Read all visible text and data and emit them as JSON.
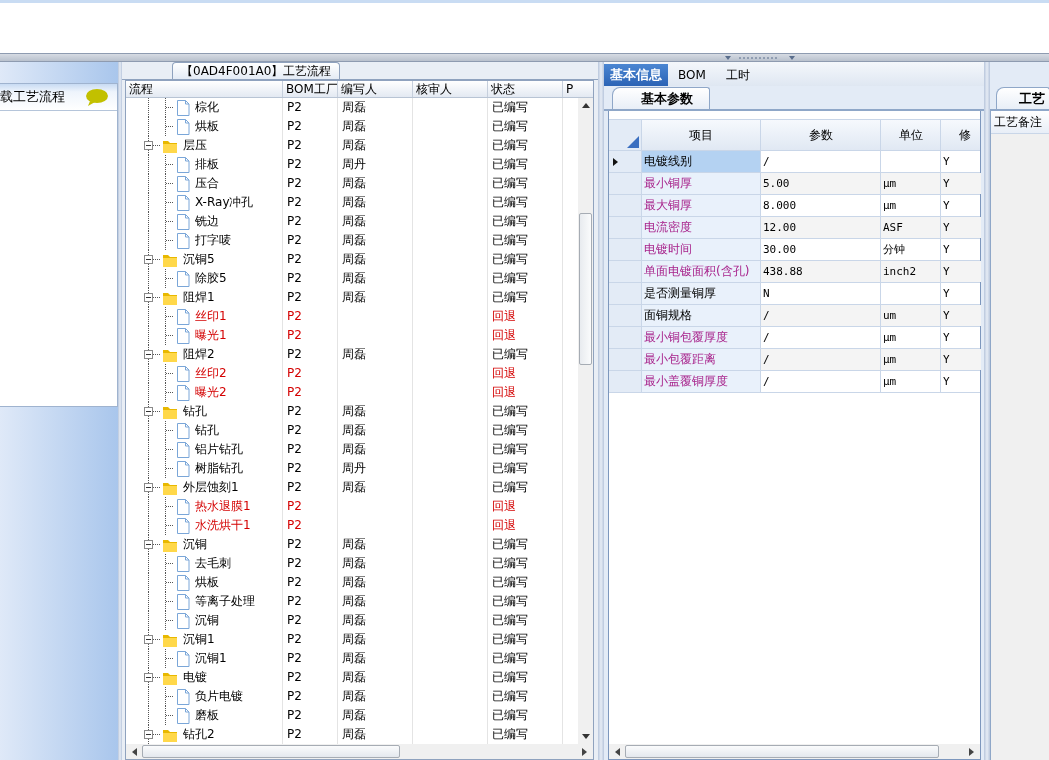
{
  "left_panel": {
    "title": "载工艺流程"
  },
  "process_panel": {
    "title": "【0AD4F001A0】工艺流程",
    "columns": [
      "流程",
      "BOM工厂",
      "编写人",
      "核审人",
      "状态",
      "P"
    ],
    "continued_children": [
      {
        "name": "棕化",
        "bom": "P2",
        "writer": "周磊",
        "status": "已编写",
        "returned": false
      },
      {
        "name": "烘板",
        "bom": "P2",
        "writer": "周磊",
        "status": "已编写",
        "returned": false
      }
    ],
    "nodes": [
      {
        "name": "层压",
        "bom": "P2",
        "writer": "周磊",
        "status": "已编写",
        "returned": false,
        "expanded": true,
        "children": [
          {
            "name": "排板",
            "bom": "P2",
            "writer": "周丹",
            "status": "已编写",
            "returned": false
          },
          {
            "name": "压合",
            "bom": "P2",
            "writer": "周磊",
            "status": "已编写",
            "returned": false
          },
          {
            "name": "X-Ray冲孔",
            "bom": "P2",
            "writer": "周磊",
            "status": "已编写",
            "returned": false
          },
          {
            "name": "铣边",
            "bom": "P2",
            "writer": "周磊",
            "status": "已编写",
            "returned": false
          },
          {
            "name": "打字唛",
            "bom": "P2",
            "writer": "周磊",
            "status": "已编写",
            "returned": false
          }
        ]
      },
      {
        "name": "沉铜5",
        "bom": "P2",
        "writer": "周磊",
        "status": "已编写",
        "returned": false,
        "expanded": true,
        "children": [
          {
            "name": "除胶5",
            "bom": "P2",
            "writer": "周磊",
            "status": "已编写",
            "returned": false
          }
        ]
      },
      {
        "name": "阻焊1",
        "bom": "P2",
        "writer": "周磊",
        "status": "已编写",
        "returned": false,
        "expanded": true,
        "children": [
          {
            "name": "丝印1",
            "bom": "P2",
            "status": "回退",
            "returned": true
          },
          {
            "name": "曝光1",
            "bom": "P2",
            "status": "回退",
            "returned": true
          }
        ]
      },
      {
        "name": "阻焊2",
        "bom": "P2",
        "writer": "周磊",
        "status": "已编写",
        "returned": false,
        "expanded": true,
        "children": [
          {
            "name": "丝印2",
            "bom": "P2",
            "status": "回退",
            "returned": true
          },
          {
            "name": "曝光2",
            "bom": "P2",
            "status": "回退",
            "returned": true
          }
        ]
      },
      {
        "name": "钻孔",
        "bom": "P2",
        "writer": "周磊",
        "status": "已编写",
        "returned": false,
        "expanded": true,
        "children": [
          {
            "name": "钻孔",
            "bom": "P2",
            "writer": "周磊",
            "status": "已编写",
            "returned": false
          },
          {
            "name": "铝片钻孔",
            "bom": "P2",
            "writer": "周磊",
            "status": "已编写",
            "returned": false
          },
          {
            "name": "树脂钻孔",
            "bom": "P2",
            "writer": "周丹",
            "status": "已编写",
            "returned": false
          }
        ]
      },
      {
        "name": "外层蚀刻1",
        "bom": "P2",
        "writer": "周磊",
        "status": "已编写",
        "returned": false,
        "expanded": true,
        "children": [
          {
            "name": "热水退膜1",
            "bom": "P2",
            "status": "回退",
            "returned": true
          },
          {
            "name": "水洗烘干1",
            "bom": "P2",
            "status": "回退",
            "returned": true
          }
        ]
      },
      {
        "name": "沉铜",
        "bom": "P2",
        "writer": "周磊",
        "status": "已编写",
        "returned": false,
        "expanded": true,
        "children": [
          {
            "name": "去毛刺",
            "bom": "P2",
            "writer": "周磊",
            "status": "已编写",
            "returned": false
          },
          {
            "name": "烘板",
            "bom": "P2",
            "writer": "周磊",
            "status": "已编写",
            "returned": false
          },
          {
            "name": "等离子处理",
            "bom": "P2",
            "writer": "周磊",
            "status": "已编写",
            "returned": false
          },
          {
            "name": "沉铜",
            "bom": "P2",
            "writer": "周磊",
            "status": "已编写",
            "returned": false
          }
        ]
      },
      {
        "name": "沉铜1",
        "bom": "P2",
        "writer": "周磊",
        "status": "已编写",
        "returned": false,
        "expanded": true,
        "children": [
          {
            "name": "沉铜1",
            "bom": "P2",
            "writer": "周磊",
            "status": "已编写",
            "returned": false
          }
        ]
      },
      {
        "name": "电镀",
        "bom": "P2",
        "writer": "周磊",
        "status": "已编写",
        "returned": false,
        "expanded": true,
        "children": [
          {
            "name": "负片电镀",
            "bom": "P2",
            "writer": "周磊",
            "status": "已编写",
            "returned": false
          },
          {
            "name": "磨板",
            "bom": "P2",
            "writer": "周磊",
            "status": "已编写",
            "returned": false
          }
        ]
      },
      {
        "name": "钻孔2",
        "bom": "P2",
        "writer": "周磊",
        "status": "已编写",
        "returned": false,
        "expanded": true
      }
    ]
  },
  "info_panel": {
    "tabs": [
      {
        "label": "基本信息",
        "selected": true
      },
      {
        "label": "BOM",
        "selected": false
      },
      {
        "label": "工时",
        "selected": false
      }
    ],
    "subtab": "基本参数",
    "columns": [
      "项目",
      "参数",
      "单位",
      "修"
    ],
    "rows": [
      {
        "item": "电镀线别",
        "required": false,
        "value": "/",
        "modified": "Y",
        "selected": true
      },
      {
        "item": "最小铜厚",
        "required": true,
        "value": "5.00",
        "unit": "µm",
        "modified": "Y",
        "selected": false
      },
      {
        "item": "最大铜厚",
        "required": true,
        "value": "8.000",
        "unit": "µm",
        "modified": "Y",
        "selected": false
      },
      {
        "item": "电流密度",
        "required": true,
        "value": "12.00",
        "unit": "ASF",
        "modified": "Y",
        "selected": false
      },
      {
        "item": "电镀时间",
        "required": true,
        "value": "30.00",
        "unit": "分钟",
        "modified": "Y",
        "selected": false
      },
      {
        "item": "单面电镀面积(含孔)",
        "required": true,
        "value": "438.88",
        "unit": "inch2",
        "modified": "Y",
        "selected": false
      },
      {
        "item": "是否测量铜厚",
        "required": false,
        "value": "N",
        "modified": "Y",
        "selected": false
      },
      {
        "item": "面铜规格",
        "required": false,
        "value": "/",
        "unit": "um",
        "modified": "Y",
        "selected": false
      },
      {
        "item": "最小铜包覆厚度",
        "required": true,
        "value": "/",
        "unit": "µm",
        "modified": "Y",
        "selected": false
      },
      {
        "item": "最小包覆距离",
        "required": true,
        "value": "/",
        "unit": "µm",
        "modified": "Y",
        "selected": false
      },
      {
        "item": "最小盖覆铜厚度",
        "required": true,
        "value": "/",
        "unit": "µm",
        "modified": "Y",
        "selected": false
      }
    ]
  },
  "notes_panel": {
    "tab": "工艺",
    "header": "工艺备注"
  }
}
